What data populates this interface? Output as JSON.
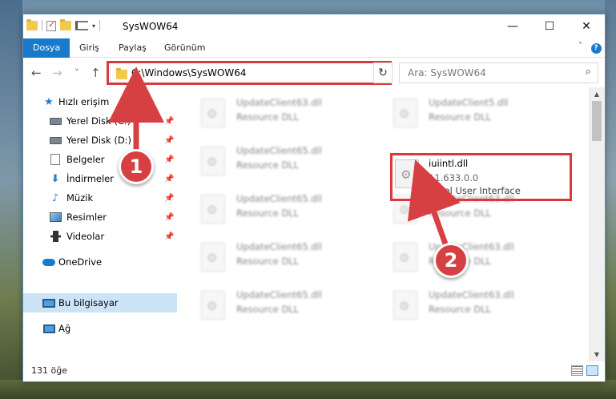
{
  "window": {
    "title": "SysWOW64",
    "min_glyph": "—",
    "max_glyph": "☐",
    "close_glyph": "✕"
  },
  "ribbon": {
    "tabs": [
      {
        "label": "Dosya",
        "active": true
      },
      {
        "label": "Giriş"
      },
      {
        "label": "Paylaş"
      },
      {
        "label": "Görünüm"
      }
    ],
    "help": "?"
  },
  "nav": {
    "back": "←",
    "forward": "→",
    "recent": "˅",
    "up": "↑",
    "address": "C:\\Windows\\SysWOW64",
    "refresh": "↻",
    "search_placeholder": "Ara: SysWOW64",
    "search_icon": "⌕"
  },
  "sidebar": {
    "items": [
      {
        "label": "Hızlı erişim",
        "icon": "star-icon",
        "pinned": false
      },
      {
        "label": "Yerel Disk (C:)",
        "icon": "drive-icon",
        "pinned": true
      },
      {
        "label": "Yerel Disk (D:)",
        "icon": "drive-icon",
        "pinned": true
      },
      {
        "label": "Belgeler",
        "icon": "documents-icon",
        "pinned": true
      },
      {
        "label": "İndirmeler",
        "icon": "downloads-icon",
        "pinned": true
      },
      {
        "label": "Müzik",
        "icon": "music-icon",
        "pinned": true
      },
      {
        "label": "Resimler",
        "icon": "pictures-icon",
        "pinned": true
      },
      {
        "label": "Videolar",
        "icon": "videos-icon",
        "pinned": true
      },
      {
        "label": "OneDrive",
        "icon": "onedrive-icon",
        "pinned": false
      },
      {
        "label": "Bu bilgisayar",
        "icon": "computer-icon",
        "pinned": false,
        "selected": true
      },
      {
        "label": "Ağ",
        "icon": "network-icon",
        "pinned": false
      }
    ],
    "pin_glyph": "📌"
  },
  "files": {
    "left_column": [
      {
        "name": "UpdateClient63.dll",
        "type": "Resource DLL"
      },
      {
        "name": "UpdateClient65.dll",
        "type": "Resource DLL"
      },
      {
        "name": "UpdateClient65.dll",
        "type": "Resource DLL"
      },
      {
        "name": "UpdateClient65.dll",
        "type": "Resource DLL"
      },
      {
        "name": "UpdateClient65.dll",
        "type": "Resource DLL"
      }
    ],
    "right_column": [
      {
        "name": "UpdateClient5.dll",
        "type": "Resource DLL"
      },
      {
        "name": "UpdateClient63.dll",
        "type": "Resource DLL"
      },
      {
        "name": "UpdateClient63.dll",
        "type": "Resource DLL"
      },
      {
        "name": "UpdateClient63.dll",
        "type": "Resource DLL"
      }
    ],
    "highlighted": {
      "name": "iuiintl.dll",
      "version": "11.633.0.0",
      "description": "Corel User Interface"
    }
  },
  "status": {
    "count": "131 öğe"
  },
  "callouts": {
    "one": "1",
    "two": "2",
    "color": "#d74043"
  },
  "scroll": {
    "up": "▲",
    "down": "▼"
  }
}
